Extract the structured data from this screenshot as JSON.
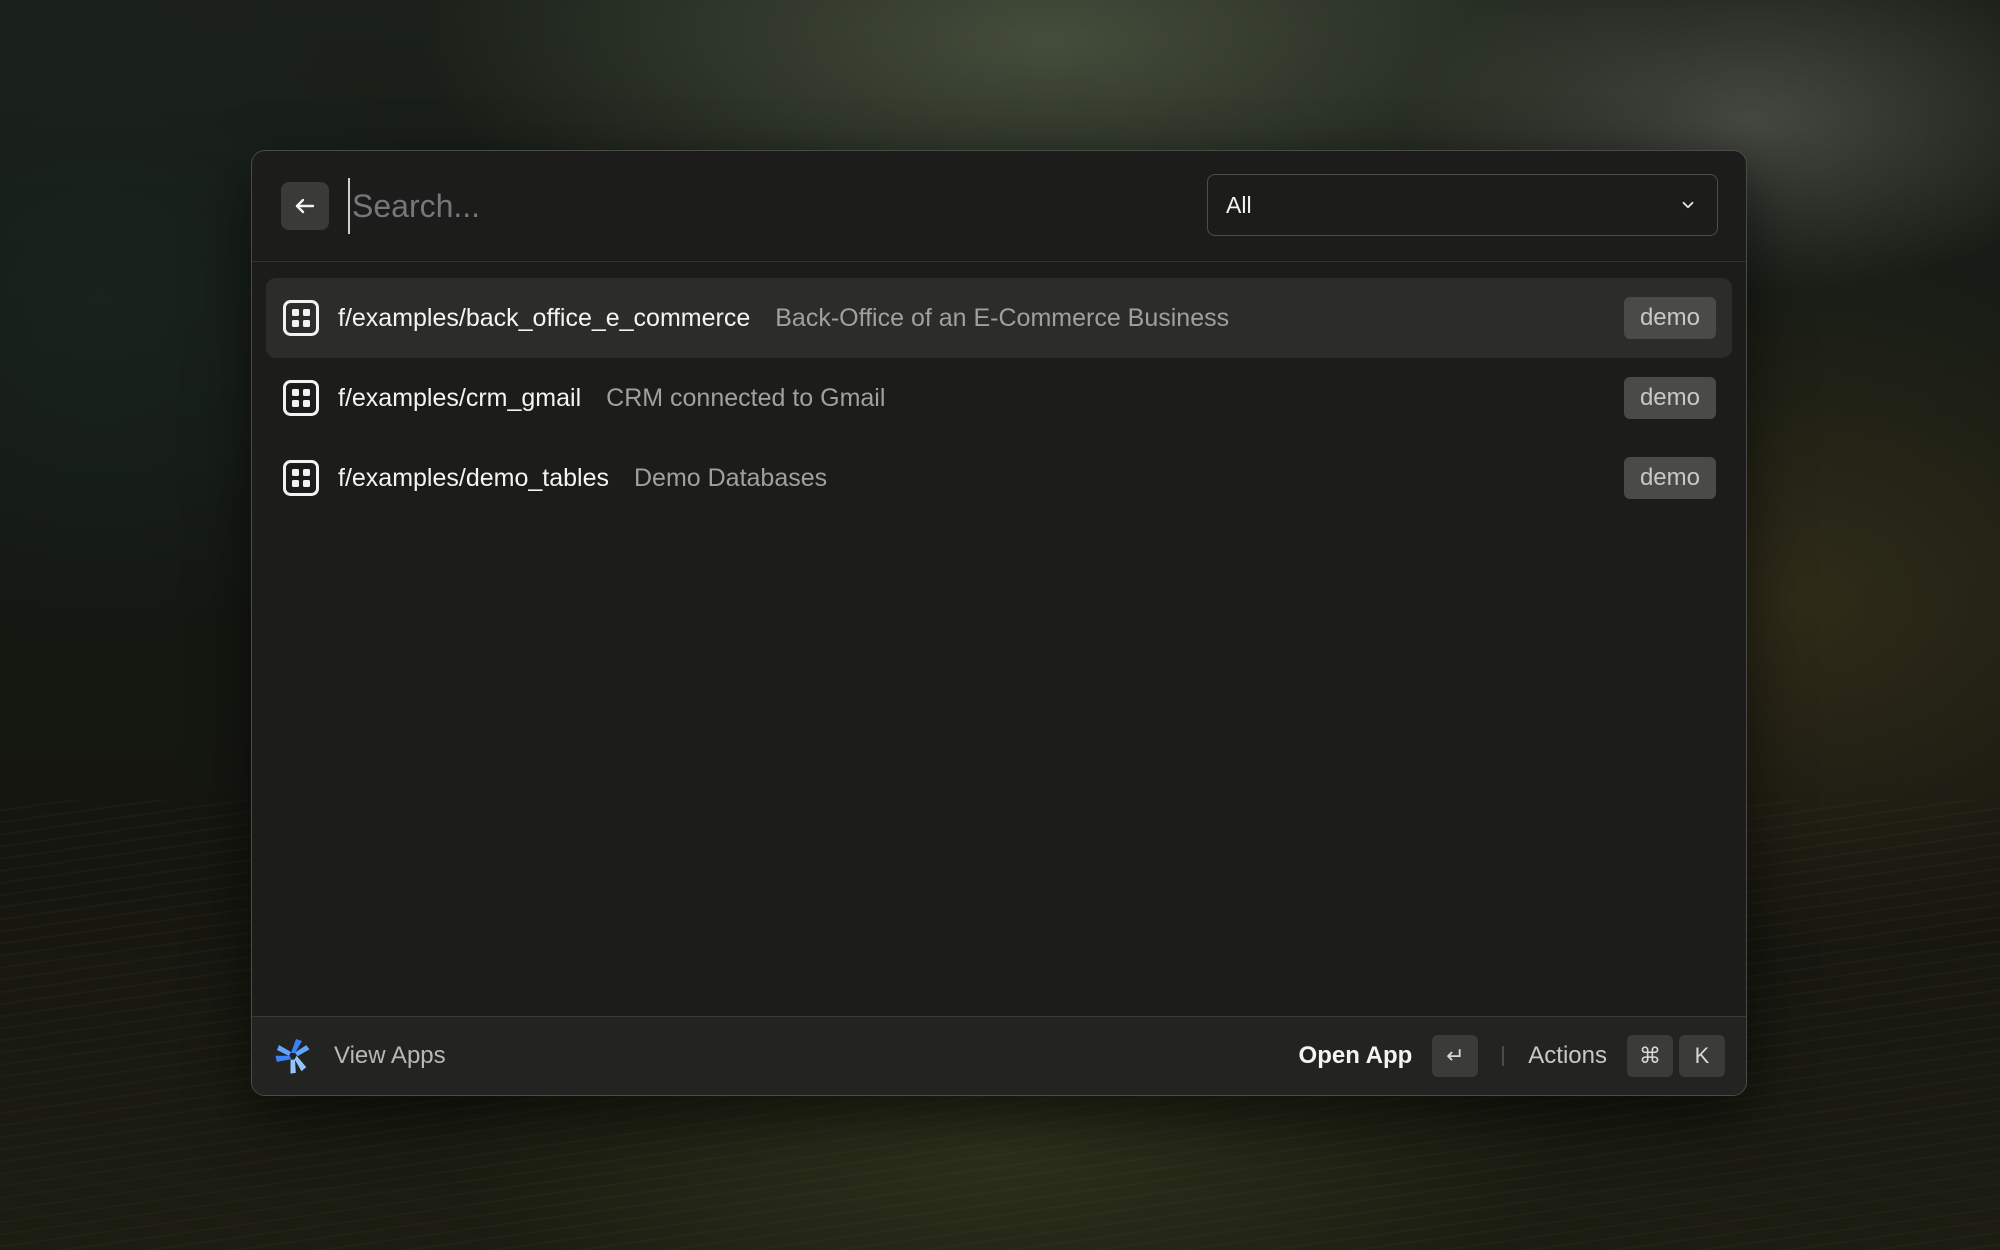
{
  "search": {
    "placeholder": "Search...",
    "value": ""
  },
  "filter": {
    "selected": "All"
  },
  "results": [
    {
      "path": "f/examples/back_office_e_commerce",
      "description": "Back-Office of an E-Commerce Business",
      "tag": "demo",
      "selected": true
    },
    {
      "path": "f/examples/crm_gmail",
      "description": "CRM connected to Gmail",
      "tag": "demo",
      "selected": false
    },
    {
      "path": "f/examples/demo_tables",
      "description": "Demo Databases",
      "tag": "demo",
      "selected": false
    }
  ],
  "footer": {
    "view_label": "View Apps",
    "primary_action": "Open App",
    "enter_key": "↵",
    "actions_label": "Actions",
    "cmd_key": "⌘",
    "k_key": "K"
  },
  "icons": {
    "back": "arrow-left-icon",
    "dropdown": "chevron-down-icon",
    "app": "app-grid-icon",
    "logo": "windmill-logo-icon"
  },
  "colors": {
    "logo_blue": "#3b82f6",
    "logo_light": "#93c5fd"
  }
}
